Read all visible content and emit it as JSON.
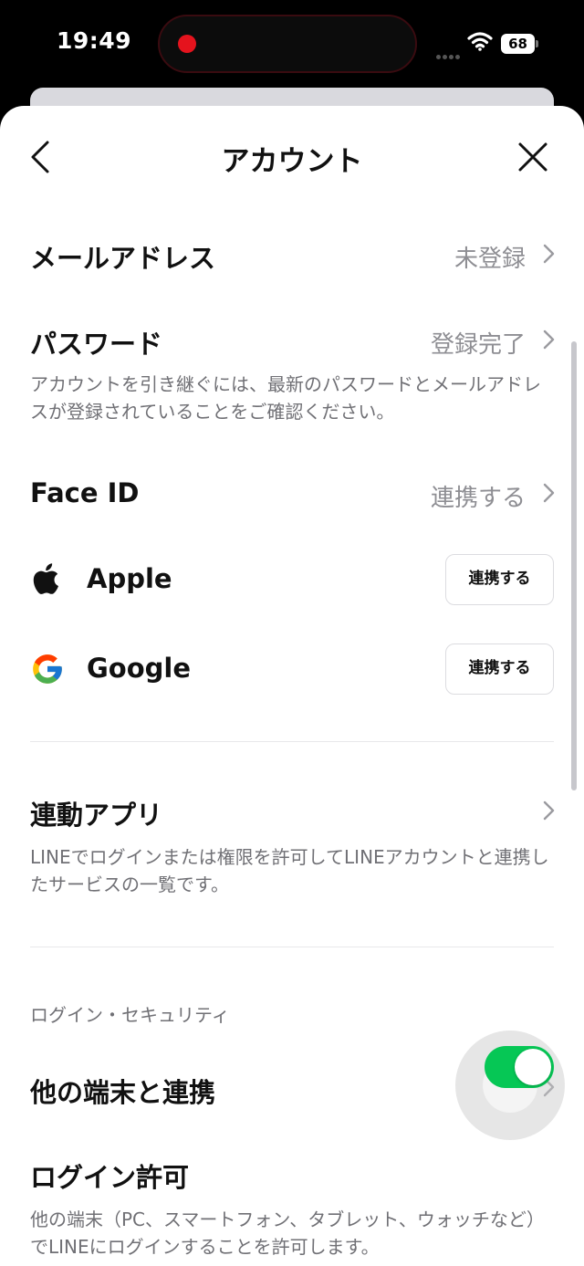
{
  "status_bar": {
    "time": "19:49",
    "battery": "68"
  },
  "nav": {
    "title": "アカウント"
  },
  "rows": {
    "email": {
      "title": "メールアドレス",
      "value": "未登録"
    },
    "password": {
      "title": "パスワード",
      "value": "登録完了",
      "description": "アカウントを引き継ぐには、最新のパスワードとメールアドレスが登録されていることをご確認ください。"
    },
    "face_id": {
      "title": "Face ID",
      "value": "連携する"
    },
    "apple": {
      "label": "Apple",
      "button": "連携する"
    },
    "google": {
      "label": "Google",
      "button": "連携する"
    },
    "linked_apps": {
      "title": "連動アプリ",
      "description": "LINEでログインまたは権限を許可してLINEアカウントと連携したサービスの一覧です。"
    }
  },
  "login_security": {
    "section_label": "ログイン・セキュリティ",
    "other_devices": {
      "title": "他の端末と連携"
    },
    "allow_login": {
      "title": "ログイン許可",
      "enabled": true,
      "description": "他の端末（PC、スマートフォン、タブレット、ウォッチなど）でLINEにログインすることを許可します。"
    }
  },
  "colors": {
    "accent_green": "#06c755",
    "secondary_text": "#8e8e93"
  }
}
